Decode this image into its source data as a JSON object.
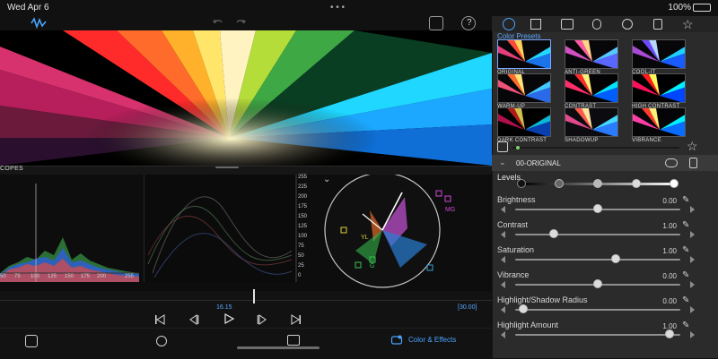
{
  "status": {
    "date": "Wed Apr 6",
    "battery_percent": "100%"
  },
  "right_panel": {
    "color_presets_title": "Color Presets",
    "presets": [
      {
        "label": "ORIGINAL"
      },
      {
        "label": "ANTI-GREEN"
      },
      {
        "label": "COOL-IT"
      },
      {
        "label": "WARM-UP"
      },
      {
        "label": "CONTRAST"
      },
      {
        "label": "HIGH CONTRAST"
      },
      {
        "label": "DARK CONTRAST"
      },
      {
        "label": "SHADOWUP"
      },
      {
        "label": "VIBRANCE"
      }
    ],
    "current_preset": "00-ORIGINAL",
    "sections": {
      "levels": "Levels"
    },
    "controls": [
      {
        "label": "Brightness",
        "value": "0.00"
      },
      {
        "label": "Contrast",
        "value": "1.00"
      },
      {
        "label": "Saturation",
        "value": "1.00"
      },
      {
        "label": "Vibrance",
        "value": "0.00"
      },
      {
        "label": "Highlight/Shadow Radius",
        "value": "0.00"
      },
      {
        "label": "Highlight Amount",
        "value": "1.00"
      }
    ]
  },
  "scopes": {
    "title": "COPES",
    "histogram_axis": [
      "50",
      "75",
      "100",
      "125",
      "150",
      "175",
      "200",
      "255"
    ],
    "waveform_axis": [
      "255",
      "225",
      "200",
      "175",
      "150",
      "125",
      "100",
      "75",
      "50",
      "25",
      "0"
    ],
    "vector_labels": [
      "MG",
      "YL",
      "G"
    ]
  },
  "timeline": {
    "time_center": "16.15",
    "time_right": "[30.00]"
  },
  "bottom": {
    "color_effects_label": "Color & Effects"
  }
}
